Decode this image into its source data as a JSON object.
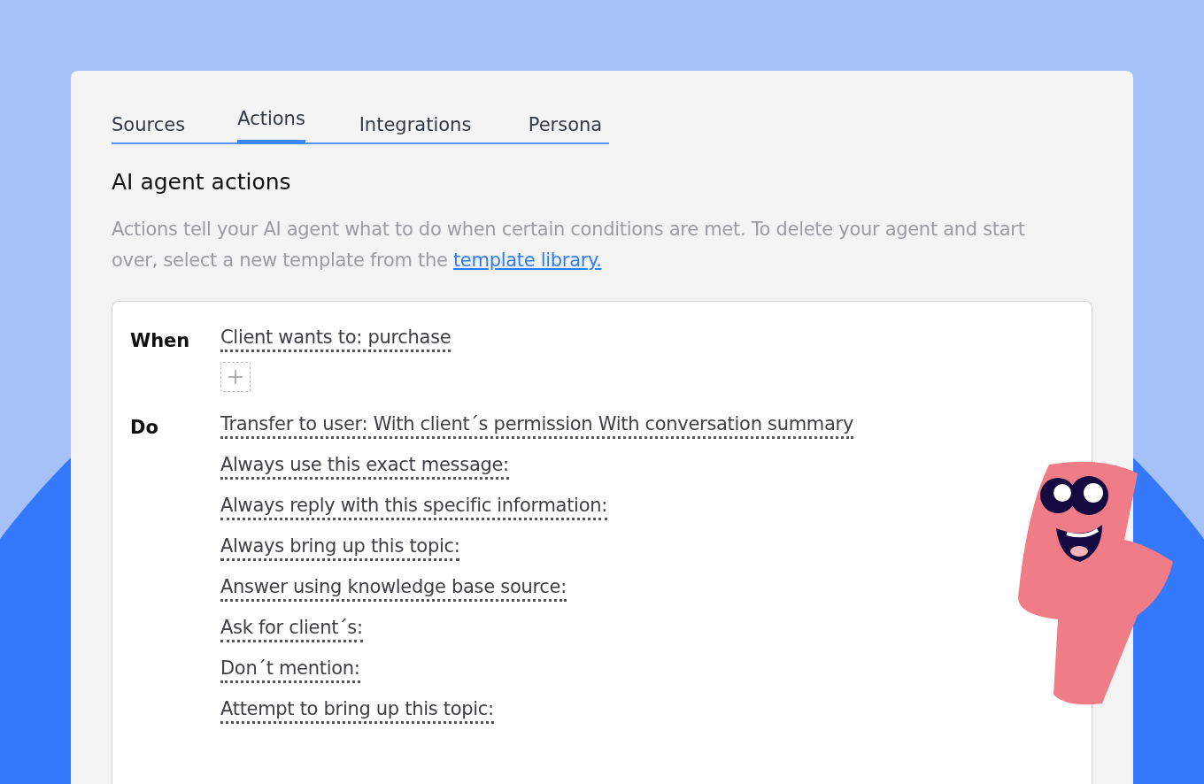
{
  "tabs": [
    {
      "label": "Sources",
      "selected": false
    },
    {
      "label": "Actions",
      "selected": true
    },
    {
      "label": "Integrations",
      "selected": false
    },
    {
      "label": "Persona",
      "selected": false
    }
  ],
  "heading": "AI agent actions",
  "description": {
    "text": "Actions tell your AI agent what to do when certain conditions are met. To delete your agent and start over, select a new template from the ",
    "link": "template library."
  },
  "rule": {
    "when_label": "When",
    "conditions": [
      "Client wants to: purchase"
    ],
    "do_label": "Do",
    "actions": [
      "Transfer to user: With client´s permission With conversation summary",
      "Always use this exact message:",
      "Always reply with this specific information:",
      "Always bring up this topic:",
      "Answer using knowledge base source:",
      "Ask for client´s:",
      "Don´t mention:",
      "Attempt to bring up this topic:"
    ]
  }
}
